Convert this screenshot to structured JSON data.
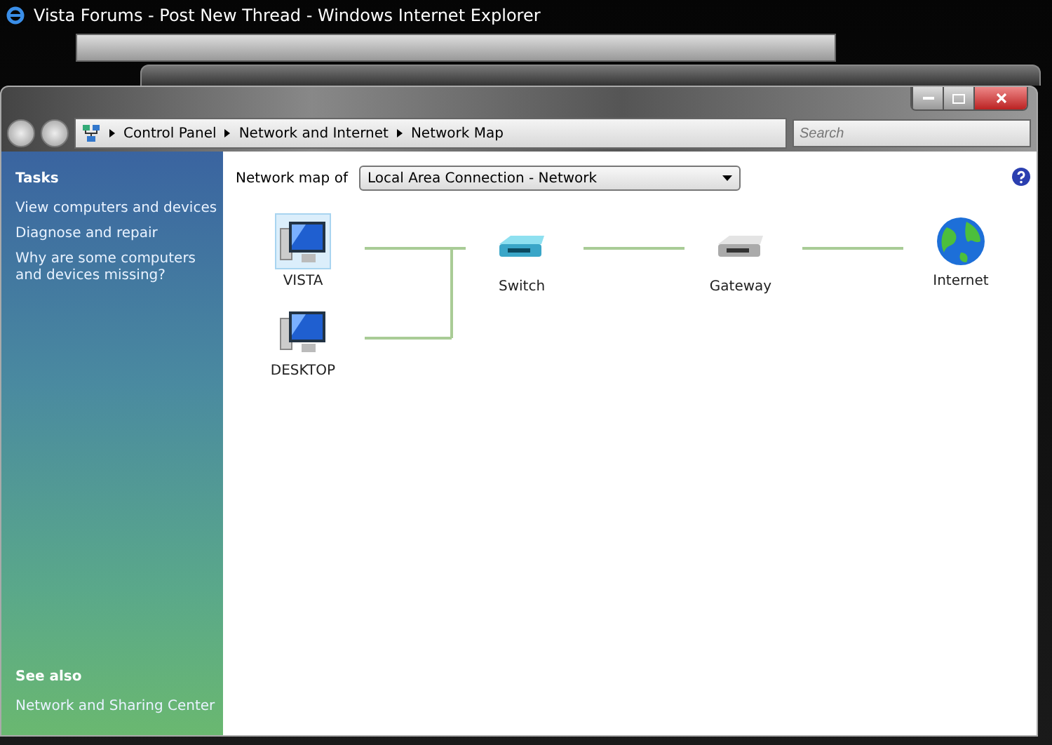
{
  "browser": {
    "title": "Vista Forums - Post New Thread - Windows Internet Explorer"
  },
  "window": {
    "breadcrumbs": [
      "Control Panel",
      "Network and Internet",
      "Network Map"
    ],
    "search": {
      "placeholder": "Search"
    }
  },
  "sidebar": {
    "tasks_heading": "Tasks",
    "tasks": [
      "View computers and devices",
      "Diagnose and repair",
      "Why are some computers and devices missing?"
    ],
    "see_also_heading": "See also",
    "see_also": [
      "Network and Sharing Center"
    ]
  },
  "map": {
    "label": "Network map of",
    "network": "Local Area Connection - Network",
    "nodes": [
      {
        "name": "VISTA",
        "kind": "computer",
        "selected": true
      },
      {
        "name": "DESKTOP",
        "kind": "computer",
        "selected": false
      },
      {
        "name": "Switch",
        "kind": "switch",
        "selected": false
      },
      {
        "name": "Gateway",
        "kind": "gateway",
        "selected": false
      },
      {
        "name": "Internet",
        "kind": "internet",
        "selected": false
      }
    ]
  }
}
